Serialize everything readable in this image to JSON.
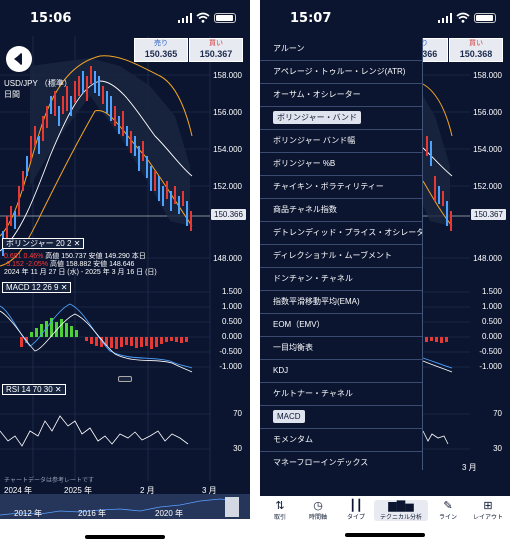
{
  "screen1": {
    "status_time": "15:06",
    "bid": {
      "label": "売り",
      "value": "150.365"
    },
    "ask": {
      "label": "買い",
      "value": "150.367"
    },
    "symbol": "USD/JPY",
    "symbol_type": "（標準）",
    "period": "日間",
    "price_axis": [
      "158.000",
      "156.000",
      "154.000",
      "152.000",
      "148.000"
    ],
    "current_price": "150.366",
    "bollinger": {
      "label": "ボリンジャー 20 2",
      "pct1": "0.691",
      "pct2": "0.46%",
      "high_label": "高値",
      "high_value": "150.737",
      "low_label": "安値",
      "low_value": "149.290",
      "close_label": "本日",
      "pct3": "-3.152",
      "pct4": "-2.05%",
      "high2_value": "158.882",
      "low2_value": "148.646",
      "date_range": "2024 年 11 月 27 日 (水) - 2025 年 3 月 16 日 (日)"
    },
    "macd": {
      "label": "MACD 12 26 9",
      "axis": [
        "1.500",
        "1.000",
        "0.500",
        "0.000",
        "-0.500",
        "-1.000"
      ]
    },
    "rsi": {
      "label": "RSI 14 70 30",
      "axis": [
        "70",
        "30"
      ]
    },
    "note": "チャートデータは参考レートです",
    "time_axis": [
      "2024 年",
      "2025 年",
      "2 月",
      "3 月"
    ],
    "overview_axis": [
      "2012 年",
      "2016 年",
      "2020 年"
    ]
  },
  "screen2": {
    "status_time": "15:07",
    "bid": {
      "label": "売り",
      "value": "150.366"
    },
    "ask": {
      "label": "買い",
      "value": "150.368"
    },
    "price_axis": [
      "158.000",
      "156.000",
      "154.000",
      "152.000",
      "148.000"
    ],
    "current_price": "150.367",
    "macd_axis": [
      "1.500",
      "1.000",
      "0.500",
      "0.000",
      "-0.500",
      "-1.000"
    ],
    "rsi_axis": [
      "70",
      "30"
    ],
    "time_axis": [
      "3 月"
    ],
    "menu_items": [
      "アルーン",
      "アペレージ・トゥルー・レンジ(ATR)",
      "オーサム・オシレーター",
      "ボリンジャー・バンド",
      "ボリンジャー バンド幅",
      "ボリンジャー %B",
      "チャイキン・ボラティリティー",
      "商品チャネル指数",
      "デトレンディッド・プライス・オシレーター",
      "ディレクショナル・ムーブメント",
      "ドンチャン・チャネル",
      "指数平滑移動平均(EMA)",
      "EOM（EMV）",
      "一目均衡表",
      "KDJ",
      "ケルトナー・チャネル",
      "MACD",
      "モメンタム",
      "マネーフローインデックス"
    ],
    "selected_items": [
      3,
      16
    ]
  },
  "tabs": [
    {
      "label": "取引",
      "icon": "arrows-icon"
    },
    {
      "label": "時間軸",
      "icon": "clock-icon"
    },
    {
      "label": "タイプ",
      "icon": "candles-icon"
    },
    {
      "label": "テクニカル分析",
      "icon": "bars-icon"
    },
    {
      "label": "ライン",
      "icon": "pen-icon"
    },
    {
      "label": "レイアウト",
      "icon": "layout-icon"
    }
  ],
  "colors": {
    "bg": "#0b1530",
    "up": "#e53935",
    "down": "#4da3ff",
    "band": "#f5a623",
    "signal": "#ffffff",
    "macd_pos": "#4cd137"
  }
}
